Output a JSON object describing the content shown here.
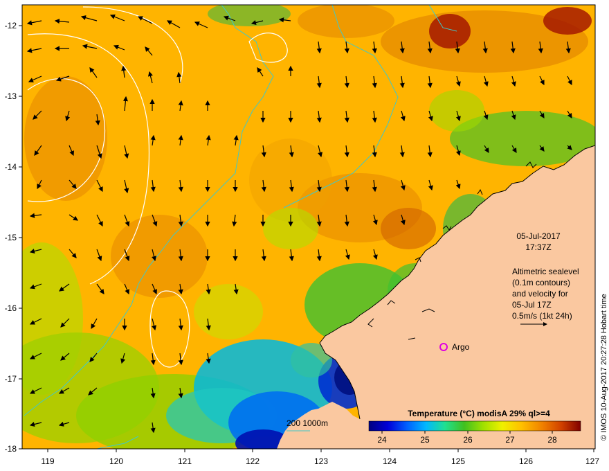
{
  "map": {
    "lon_ticks": [
      "119",
      "120",
      "121",
      "122",
      "123",
      "124",
      "125",
      "126",
      "127"
    ],
    "lat_ticks": [
      "-12",
      "-13",
      "-14",
      "-15",
      "-16",
      "-17",
      "-18"
    ],
    "lon_range": [
      118.6,
      127
    ],
    "lat_range": [
      -18,
      -11.7
    ]
  },
  "annotations": {
    "date": "05-Jul-2017",
    "time": "17:37Z",
    "altimetry_lines": [
      "Altimetric sealevel",
      "(0.1m contours)",
      "and velocity for",
      "05-Jul 17Z",
      "0.5m/s (1kt 24h)"
    ],
    "argo_label": "Argo",
    "bathy_label": "200  1000m"
  },
  "colorbar": {
    "title": "Temperature (°C) modisA 29% ql>=4",
    "tick_labels": [
      "24",
      "25",
      "26",
      "27",
      "28"
    ],
    "stops": [
      "#000080",
      "#0000d8",
      "#0060ff",
      "#00b8ff",
      "#20e090",
      "#40c020",
      "#a0e000",
      "#f0f000",
      "#ffc000",
      "#f08000",
      "#d04000",
      "#800000"
    ]
  },
  "credit": "© IMOS 10-Aug-2017 20:27:28 Hobart time",
  "colors": {
    "land": "#fac8a0",
    "ocean_warm": "#ffb400",
    "ocean_hot": "#e07800",
    "ocean_green": "#80c800",
    "ocean_cold": "#0050d8",
    "bathy_line": "#40c8c8",
    "argo": "#e000e0"
  }
}
